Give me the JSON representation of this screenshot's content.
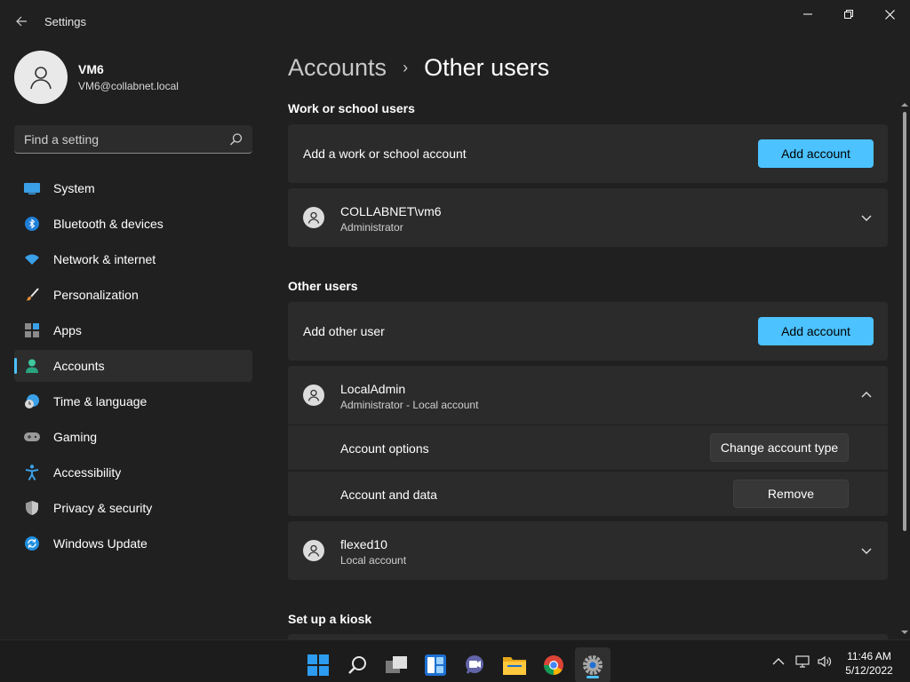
{
  "window": {
    "title": "Settings"
  },
  "profile": {
    "name": "VM6",
    "email": "VM6@collabnet.local"
  },
  "search": {
    "placeholder": "Find a setting"
  },
  "nav": {
    "items": [
      {
        "label": "System",
        "icon": "system-icon"
      },
      {
        "label": "Bluetooth & devices",
        "icon": "bluetooth-icon"
      },
      {
        "label": "Network & internet",
        "icon": "wifi-icon"
      },
      {
        "label": "Personalization",
        "icon": "brush-icon"
      },
      {
        "label": "Apps",
        "icon": "apps-icon"
      },
      {
        "label": "Accounts",
        "icon": "accounts-icon",
        "active": true
      },
      {
        "label": "Time & language",
        "icon": "clock-globe-icon"
      },
      {
        "label": "Gaming",
        "icon": "gamepad-icon"
      },
      {
        "label": "Accessibility",
        "icon": "accessibility-icon"
      },
      {
        "label": "Privacy & security",
        "icon": "shield-icon"
      },
      {
        "label": "Windows Update",
        "icon": "update-icon"
      }
    ]
  },
  "breadcrumb": {
    "parent": "Accounts",
    "separator": "›",
    "current": "Other users"
  },
  "work_section": {
    "title": "Work or school users",
    "add_label": "Add a work or school account",
    "add_button": "Add account",
    "users": [
      {
        "name": "COLLABNET\\vm6",
        "role": "Administrator",
        "expanded": false
      }
    ]
  },
  "other_section": {
    "title": "Other users",
    "add_label": "Add other user",
    "add_button": "Add account",
    "users": [
      {
        "name": "LocalAdmin",
        "role": "Administrator - Local account",
        "expanded": true,
        "options_label": "Account options",
        "options_button": "Change account type",
        "data_label": "Account and data",
        "data_button": "Remove"
      },
      {
        "name": "flexed10",
        "role": "Local account",
        "expanded": false
      }
    ]
  },
  "kiosk_section": {
    "title": "Set up a kiosk"
  },
  "taskbar": {
    "time": "11:46 AM",
    "date": "5/12/2022",
    "apps": [
      "start-icon",
      "search-icon",
      "task-view-icon",
      "widgets-icon",
      "teams-chat-icon",
      "file-explorer-icon",
      "chrome-icon",
      "settings-icon"
    ]
  },
  "colors": {
    "accent": "#4cc2ff",
    "background": "#202020",
    "card": "#2b2b2b"
  }
}
